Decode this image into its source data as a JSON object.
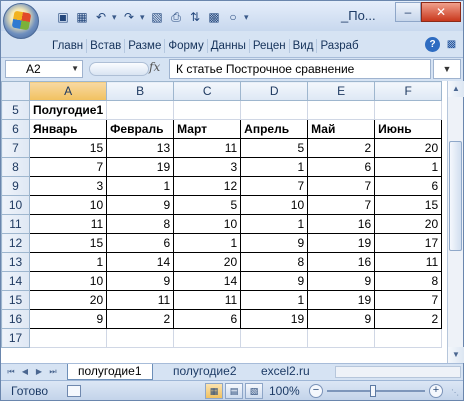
{
  "titlebar": {
    "title": "_По...",
    "qat_icons": [
      "save-icon",
      "print-preview-icon",
      "undo-icon",
      "redo-icon",
      "paste-icon",
      "print-icon",
      "sort-icon",
      "chart-icon",
      "circle-icon"
    ]
  },
  "ribbon": {
    "tabs": [
      "Главн",
      "Встав",
      "Разме",
      "Форму",
      "Данны",
      "Рецен",
      "Вид",
      "Разраб"
    ]
  },
  "formula_bar": {
    "name_box": "A2",
    "fx": "fx",
    "content": "К статье Построчное сравнение"
  },
  "sheet": {
    "columns": [
      "A",
      "B",
      "C",
      "D",
      "E",
      "F"
    ],
    "selected_column": "A",
    "rows": [
      {
        "num": "5",
        "cells": [
          "Полугодие1",
          "",
          "",
          "",
          "",
          ""
        ],
        "header": "title"
      },
      {
        "num": "6",
        "cells": [
          "Январь",
          "Февраль",
          "Март",
          "Апрель",
          "Май",
          "Июнь"
        ],
        "header": "bold"
      },
      {
        "num": "7",
        "cells": [
          "15",
          "13",
          "11",
          "5",
          "2",
          "20"
        ]
      },
      {
        "num": "8",
        "cells": [
          "7",
          "19",
          "3",
          "1",
          "6",
          "1"
        ]
      },
      {
        "num": "9",
        "cells": [
          "3",
          "1",
          "12",
          "7",
          "7",
          "6"
        ]
      },
      {
        "num": "10",
        "cells": [
          "10",
          "9",
          "5",
          "10",
          "7",
          "15"
        ]
      },
      {
        "num": "11",
        "cells": [
          "11",
          "8",
          "10",
          "1",
          "16",
          "20"
        ]
      },
      {
        "num": "12",
        "cells": [
          "15",
          "6",
          "1",
          "9",
          "19",
          "17"
        ]
      },
      {
        "num": "13",
        "cells": [
          "1",
          "14",
          "20",
          "8",
          "16",
          "11"
        ]
      },
      {
        "num": "14",
        "cells": [
          "10",
          "9",
          "14",
          "9",
          "9",
          "8"
        ]
      },
      {
        "num": "15",
        "cells": [
          "20",
          "11",
          "11",
          "1",
          "19",
          "7"
        ]
      },
      {
        "num": "16",
        "cells": [
          "9",
          "2",
          "6",
          "19",
          "9",
          "2"
        ]
      },
      {
        "num": "17",
        "cells": [
          "",
          "",
          "",
          "",
          "",
          ""
        ]
      }
    ]
  },
  "sheet_tabs": {
    "active": "полугодие1",
    "others": [
      "полугодие2",
      "excel2.ru"
    ]
  },
  "status_bar": {
    "ready": "Готово",
    "zoom": "100%"
  }
}
